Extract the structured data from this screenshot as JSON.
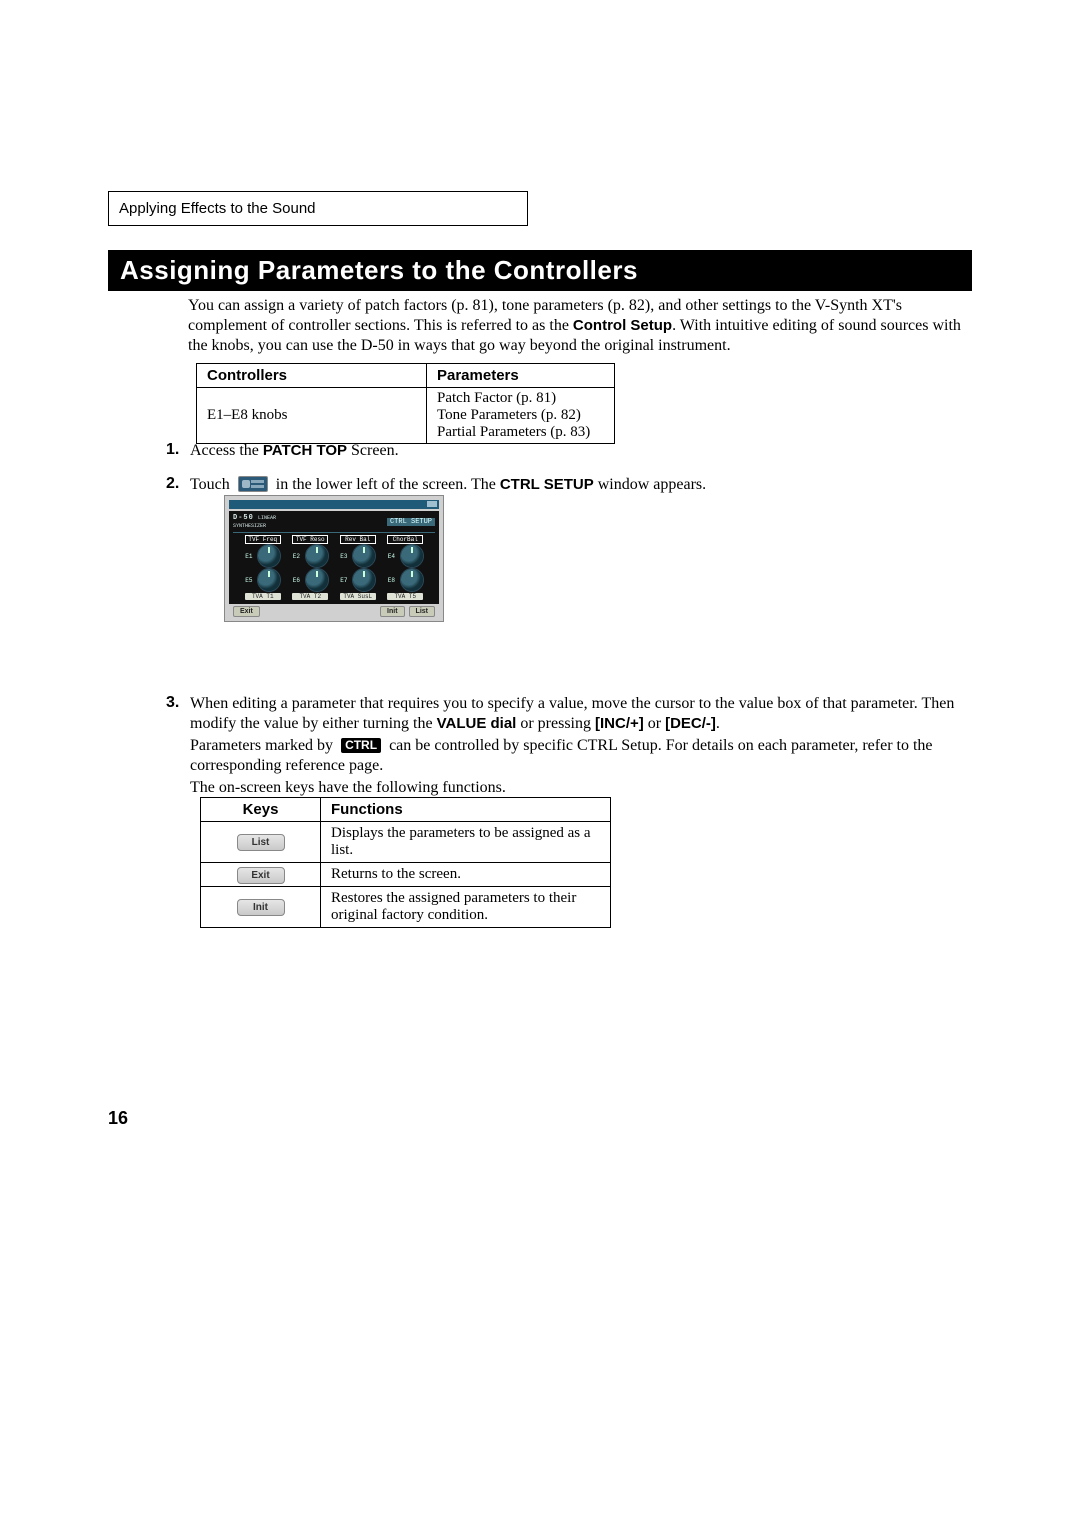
{
  "header": {
    "breadcrumb": "Applying Effects to the Sound"
  },
  "section": {
    "title": "Assigning Parameters to the Controllers"
  },
  "intro": {
    "p1a": "You can assign a variety of patch factors (p. 81), tone parameters (p. 82), and other settings to the V-Synth XT's complement of controller sections. This is referred to as the ",
    "p1b": "Control Setup",
    "p1c": ". With intuitive editing of sound sources with the knobs, you can use the D-50 in ways that go way beyond the original instrument."
  },
  "table1": {
    "headers": [
      "Controllers",
      "Parameters"
    ],
    "row": {
      "controller": "E1–E8 knobs",
      "params": [
        "Patch Factor (p. 81)",
        "Tone Parameters (p. 82)",
        "Partial Parameters (p. 83)"
      ]
    }
  },
  "steps": {
    "s1": {
      "num": "1.",
      "a": "Access the ",
      "b": "PATCH TOP",
      "c": " Screen."
    },
    "s2": {
      "num": "2.",
      "a": "Touch ",
      "b": " in the lower left of the screen. The ",
      "c": "CTRL SETUP",
      "d": " window appears."
    },
    "s3": {
      "num": "3.",
      "p1a": "When editing a parameter that requires you to specify a value, move the cursor to the value box of that parameter. Then modify the value by either turning the ",
      "p1_value_dial": "VALUE dial",
      "p1b": " or pressing ",
      "p1_inc": "[INC/+]",
      "p1c": " or ",
      "p1_dec": "[DEC/-]",
      "p1d": ".",
      "p2a": "Parameters marked by ",
      "p2_ctrl": "CTRL",
      "p2b": " can be controlled by specific CTRL Setup. For details on each parameter, refer to the corresponding reference page.",
      "p3": "The on-screen keys have the following functions."
    }
  },
  "ctrlPanel": {
    "logo": "D-50",
    "sub1": "LINEAR",
    "sub2": "SYNTHESIZER",
    "title": "CTRL SETUP",
    "topLabels": [
      "TVF Freq",
      "TVF Reso",
      "Rev Bal",
      "ChorBal"
    ],
    "row1": [
      "E1",
      "E2",
      "E3",
      "E4"
    ],
    "row2": [
      "E5",
      "E6",
      "E7",
      "E8"
    ],
    "botLabels": [
      "TVA T1",
      "TVA T2",
      "TVA SusL",
      "TVA T5"
    ],
    "footer": {
      "exit": "Exit",
      "init": "Init",
      "list": "List"
    }
  },
  "table2": {
    "headers": [
      "Keys",
      "Functions"
    ],
    "rows": [
      {
        "key": "List",
        "fn": "Displays the parameters to be assigned as a list."
      },
      {
        "key": "Exit",
        "fn": "Returns to the screen."
      },
      {
        "key": "Init",
        "fn": "Restores the assigned parameters to their original factory condition."
      }
    ]
  },
  "page": {
    "num": "16"
  }
}
